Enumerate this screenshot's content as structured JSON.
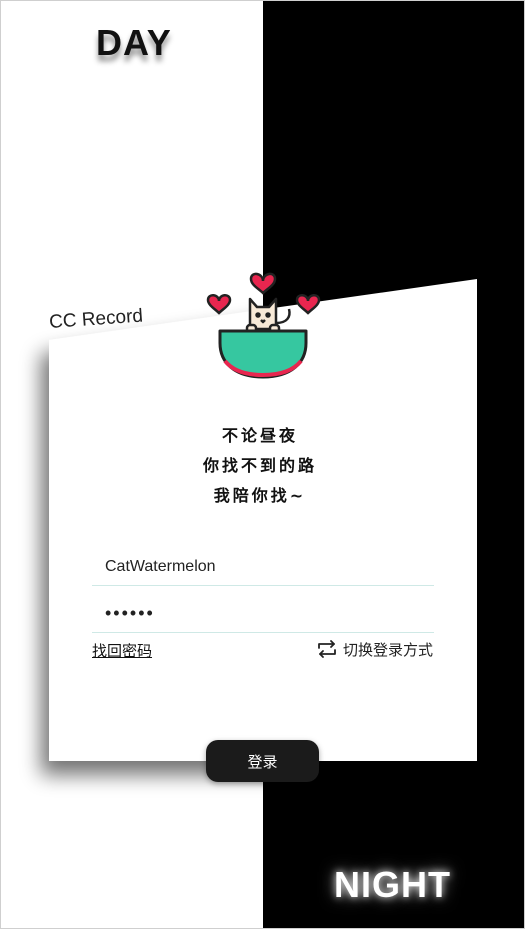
{
  "theme": {
    "day_color": "#ffffff",
    "night_color": "#000000",
    "accent_teal": "#36c7a0",
    "accent_heart": "#e8264f"
  },
  "labels": {
    "day": "DAY",
    "night": "NIGHT"
  },
  "brand": {
    "name": "CC Record"
  },
  "mascot": {
    "icon": "cat-in-bowl-with-hearts-icon"
  },
  "tagline": {
    "line1": "不论昼夜",
    "line2": "你找不到的路",
    "line3": "我陪你找~"
  },
  "form": {
    "username_value": "CatWatermelon",
    "password_value": "••••••",
    "forgot_password": "找回密码",
    "switch_login": "切换登录方式",
    "switch_icon": "swap-arrows-icon",
    "login_button": "登录"
  }
}
